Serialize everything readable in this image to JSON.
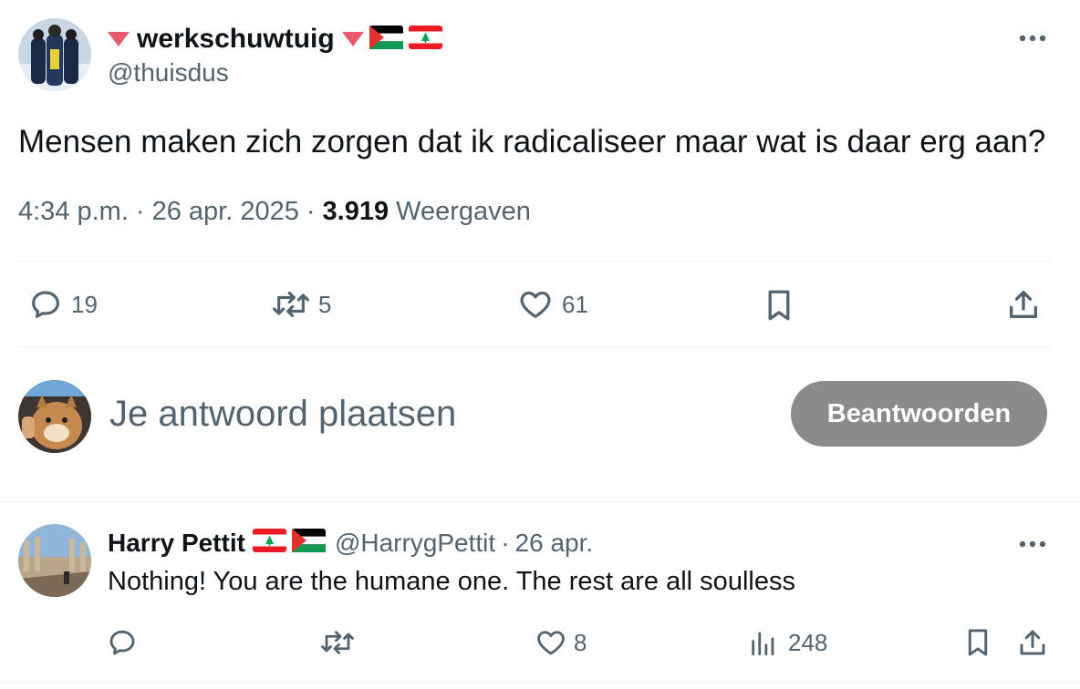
{
  "tweet": {
    "display_name": "werkschuwtuig",
    "handle": "@thuisdus",
    "text": "Mensen maken zich zorgen dat ik radicaliseer maar wat is daar erg aan?",
    "time": "4:34 p.m.",
    "date": "26 apr. 2025",
    "separator": "·",
    "views_count": "3.919",
    "views_label": "Weergaven",
    "replies": "19",
    "retweets": "5",
    "likes": "61"
  },
  "compose": {
    "placeholder": "Je antwoord plaatsen",
    "button_label": "Beantwoorden"
  },
  "reply": {
    "display_name": "Harry Pettit",
    "handle": "@HarrygPettit",
    "separator": "·",
    "date": "26 apr.",
    "text": "Nothing! You are the humane one. The rest are all soulless",
    "likes": "8",
    "views": "248"
  },
  "icons": {
    "more": "more-horizontal-icon",
    "reply": "speech-bubble-icon",
    "retweet": "retweet-arrows-icon",
    "like": "heart-icon",
    "bookmark": "bookmark-icon",
    "share": "share-upload-icon",
    "views": "bar-chart-icon"
  },
  "colors": {
    "name_triangle": "#e8596a",
    "button_bg": "#8b8b8b",
    "muted_text": "#536471",
    "divider": "#eff3f4"
  }
}
